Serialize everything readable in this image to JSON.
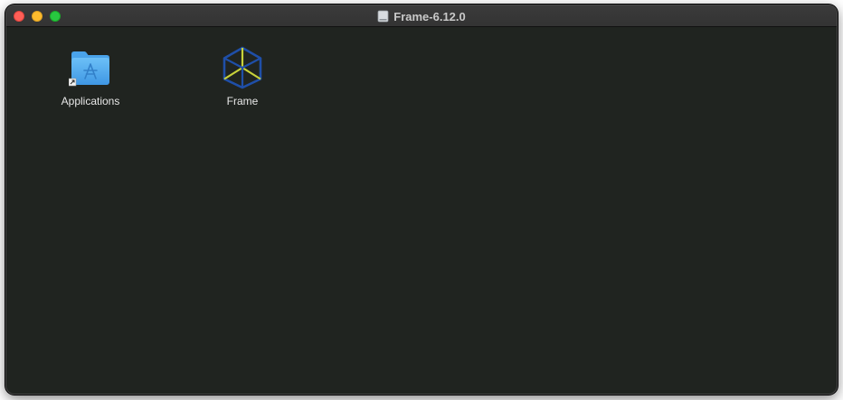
{
  "window": {
    "title": "Frame-6.12.0"
  },
  "items": [
    {
      "label": "Applications",
      "icon": "applications-folder-icon"
    },
    {
      "label": "Frame",
      "icon": "frame-app-icon"
    }
  ],
  "colors": {
    "window_bg": "#202420",
    "folder_blue": "#5ab0f0",
    "frame_blue": "#1f4fa8",
    "frame_yellow": "#c8d23a"
  }
}
